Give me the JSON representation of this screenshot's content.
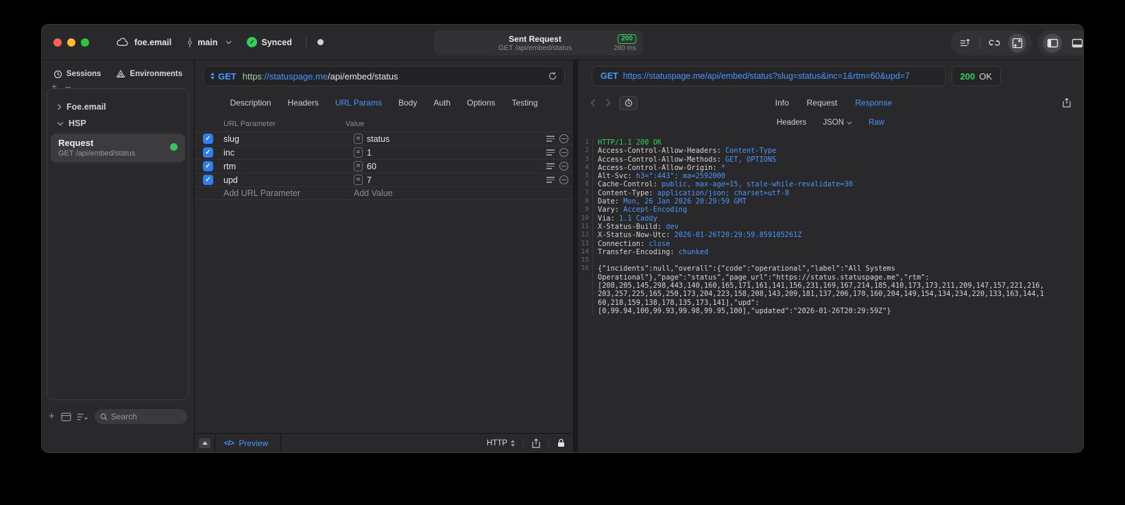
{
  "colors": {
    "accent_blue": "#4797ff",
    "status_green": "#30d158",
    "checkbox_blue": "#2d7ff0"
  },
  "titlebar": {
    "project": "foe.email",
    "branch": "main",
    "sync_label": "Synced",
    "center": {
      "title": "Sent Request",
      "subtitle": "GET /api/embed/status",
      "status_code": "200",
      "duration": "280 ms"
    }
  },
  "sidebar": {
    "tabs": [
      {
        "label": "Sessions"
      },
      {
        "label": "Environments"
      }
    ],
    "groups": [
      {
        "label": "Foe.email",
        "expanded": false
      },
      {
        "label": "HSP",
        "expanded": true
      }
    ],
    "request": {
      "title": "Request",
      "subtitle": "GET /api/embed/status"
    },
    "search_placeholder": "Search"
  },
  "request_editor": {
    "method": "GET",
    "url": {
      "scheme": "https",
      "host": "://statuspage.me",
      "path": "/api/embed/status"
    },
    "tabs": [
      "Description",
      "Headers",
      "URL Params",
      "Body",
      "Auth",
      "Options",
      "Testing"
    ],
    "active_tab": "URL Params",
    "params": {
      "col_name": "URL Parameter",
      "col_value": "Value",
      "rows": [
        {
          "name": "slug",
          "value": "status",
          "enabled": true
        },
        {
          "name": "inc",
          "value": "1",
          "enabled": true
        },
        {
          "name": "rtm",
          "value": "60",
          "enabled": true
        },
        {
          "name": "upd",
          "value": "7",
          "enabled": true
        }
      ],
      "add_name": "Add URL Parameter",
      "add_value": "Add Value"
    },
    "footer": {
      "preview": "Preview",
      "protocol": "HTTP"
    }
  },
  "response_viewer": {
    "method": "GET",
    "url": "https://statuspage.me/api/embed/status?slug=status&inc=1&rtm=60&upd=7",
    "status_code": "200",
    "status_text": "OK",
    "tabs": [
      "Info",
      "Request",
      "Response"
    ],
    "active_tab": "Response",
    "subtabs": [
      "Headers",
      "JSON",
      "Raw"
    ],
    "active_subtab": "Raw",
    "lines": [
      {
        "n": "1",
        "kind": "status",
        "text": "HTTP/1.1 200 OK"
      },
      {
        "n": "2",
        "kind": "header",
        "name": "Access-Control-Allow-Headers:",
        "value": "Content-Type"
      },
      {
        "n": "3",
        "kind": "header",
        "name": "Access-Control-Allow-Methods:",
        "value": "GET, OPTIONS"
      },
      {
        "n": "4",
        "kind": "header",
        "name": "Access-Control-Allow-Origin:",
        "value": "*"
      },
      {
        "n": "5",
        "kind": "header",
        "name": "Alt-Svc:",
        "value": "h3=\":443\"; ma=2592000"
      },
      {
        "n": "6",
        "kind": "header",
        "name": "Cache-Control:",
        "value": "public, max-age=15, stale-while-revalidate=30"
      },
      {
        "n": "7",
        "kind": "header",
        "name": "Content-Type:",
        "value": "application/json; charset=utf-8"
      },
      {
        "n": "8",
        "kind": "header",
        "name": "Date:",
        "value": "Mon, 26 Jan 2026 20:29:59 GMT"
      },
      {
        "n": "9",
        "kind": "header",
        "name": "Vary:",
        "value": "Accept-Encoding"
      },
      {
        "n": "10",
        "kind": "header",
        "name": "Via:",
        "value": "1.1 Caddy"
      },
      {
        "n": "11",
        "kind": "header",
        "name": "X-Status-Build:",
        "value": "dev"
      },
      {
        "n": "12",
        "kind": "header",
        "name": "X-Status-Now-Utc:",
        "value": "2026-01-26T20:29:59.859105261Z"
      },
      {
        "n": "13",
        "kind": "header",
        "name": "Connection:",
        "value": "close"
      },
      {
        "n": "14",
        "kind": "header",
        "name": "Transfer-Encoding:",
        "value": "chunked"
      },
      {
        "n": "15",
        "kind": "blank",
        "text": ""
      },
      {
        "n": "16",
        "kind": "body",
        "text": "{\"incidents\":null,\"overall\":{\"code\":\"operational\",\"label\":\"All Systems"
      },
      {
        "n": "",
        "kind": "body",
        "text": "Operational\"},\"page\":\"status\",\"page_url\":\"https://status.statuspage.me\",\"rtm\":"
      },
      {
        "n": "",
        "kind": "body",
        "text": "[208,205,145,298,443,140,160,165,171,161,141,156,231,169,167,214,185,410,173,173,211,209,147,157,221,216,"
      },
      {
        "n": "",
        "kind": "body",
        "text": "203,257,225,165,250,173,204,223,158,208,143,209,181,137,206,170,160,204,149,154,134,234,220,133,163,144,1"
      },
      {
        "n": "",
        "kind": "body",
        "text": "60,218,159,138,178,135,173,141],\"upd\":"
      },
      {
        "n": "",
        "kind": "body",
        "text": "[0,99.94,100,99.93,99.98,99.95,100],\"updated\":\"2026-01-26T20:29:59Z\"}"
      }
    ]
  }
}
